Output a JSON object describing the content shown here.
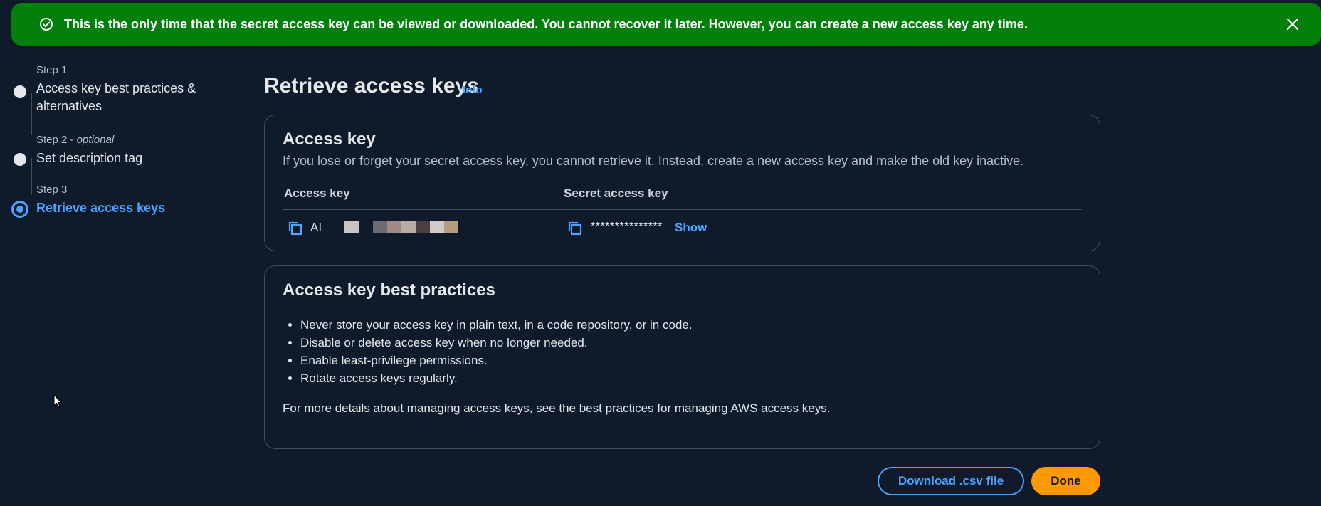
{
  "flash": {
    "message": "This is the only time that the secret access key can be viewed or downloaded. You cannot recover it later. However, you can create a new access key any time.",
    "icon": "check-circle-icon",
    "close_icon": "close-icon",
    "color": "#037f0c"
  },
  "steps": [
    {
      "number": "Step 1",
      "optional": "",
      "title": "Access key best practices & alternatives",
      "state": "complete"
    },
    {
      "number": "Step 2",
      "optional": "optional",
      "title": "Set description tag",
      "state": "complete"
    },
    {
      "number": "Step 3",
      "optional": "",
      "title": "Retrieve access keys",
      "state": "active"
    }
  ],
  "page": {
    "title": "Retrieve access keys",
    "info_link": "Info"
  },
  "access_key_card": {
    "heading": "Access key",
    "description": "If you lose or forget your secret access key, you cannot retrieve it. Instead, create a new access key and make the old key inactive.",
    "access_key_label": "Access key",
    "access_key_prefix": "AI",
    "secret_label": "Secret access key",
    "secret_masked": "***************",
    "show_label": "Show"
  },
  "best_practices_card": {
    "heading": "Access key best practices",
    "items": [
      "Never store your access key in plain text, in a code repository, or in code.",
      "Disable or delete access key when no longer needed.",
      "Enable least-privilege permissions.",
      "Rotate access keys regularly."
    ],
    "more": "For more details about managing access keys, see the best practices for managing AWS access keys."
  },
  "actions": {
    "download_label": "Download .csv file",
    "done_label": "Done"
  },
  "colors": {
    "accent": "#4da3ff",
    "primary_button": "#ff9900",
    "background": "#0f1b2a"
  }
}
